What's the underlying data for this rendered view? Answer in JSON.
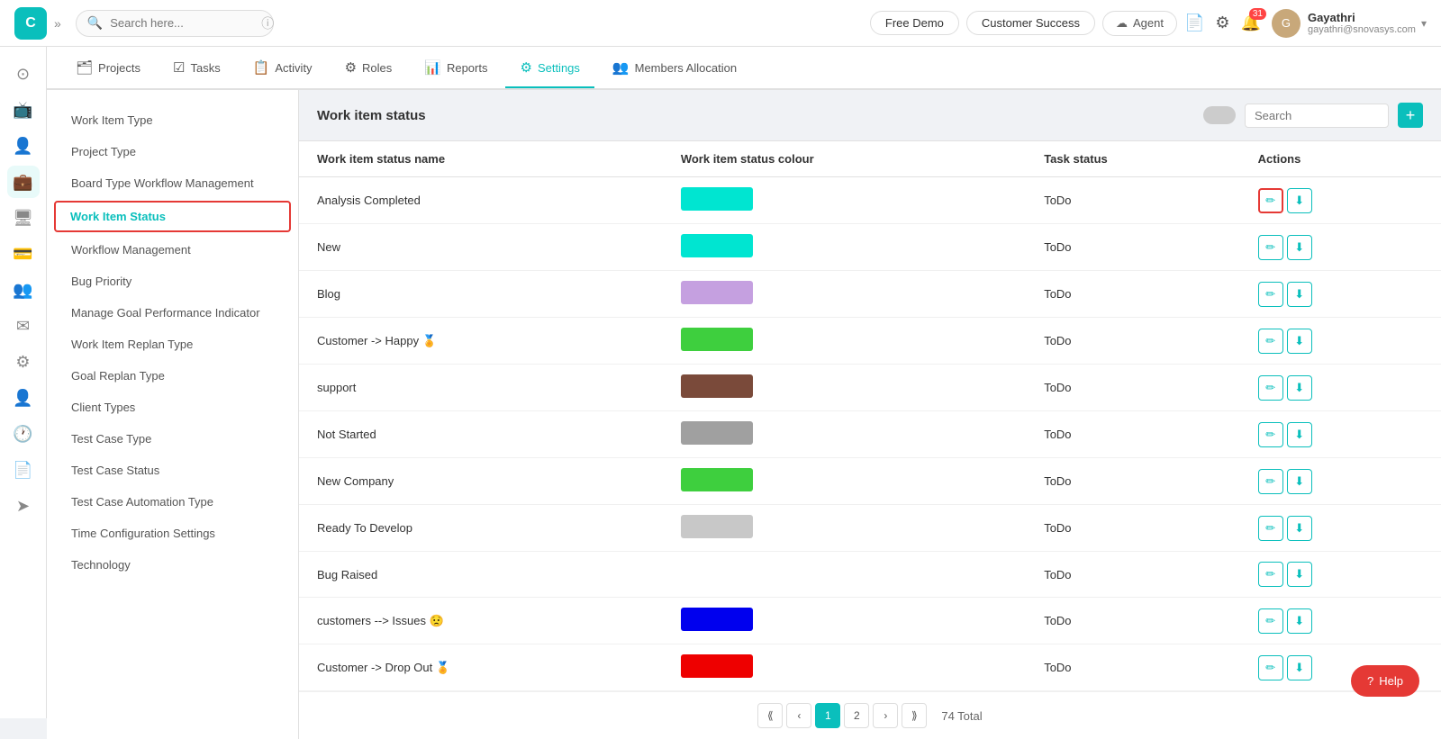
{
  "topbar": {
    "logo_letter": "C",
    "search_placeholder": "Search here...",
    "free_demo_label": "Free Demo",
    "customer_success_label": "Customer Success",
    "agent_label": "Agent",
    "notification_count": "31",
    "user": {
      "name": "Gayathri",
      "email": "gayathri@snovasys.com"
    }
  },
  "sidebar_icons": [
    {
      "name": "home-icon",
      "symbol": "⊙",
      "active": false
    },
    {
      "name": "tv-icon",
      "symbol": "📺",
      "active": false
    },
    {
      "name": "person-icon",
      "symbol": "👤",
      "active": false
    },
    {
      "name": "briefcase-icon",
      "symbol": "💼",
      "active": true
    },
    {
      "name": "monitor-icon",
      "symbol": "🖥",
      "active": false
    },
    {
      "name": "card-icon",
      "symbol": "💳",
      "active": false
    },
    {
      "name": "team-icon",
      "symbol": "👥",
      "active": false
    },
    {
      "name": "mail-icon",
      "symbol": "✉",
      "active": false
    },
    {
      "name": "gear-icon",
      "symbol": "⚙",
      "active": false
    },
    {
      "name": "user2-icon",
      "symbol": "👤",
      "active": false
    },
    {
      "name": "clock-icon",
      "symbol": "🕐",
      "active": false
    },
    {
      "name": "doc-icon",
      "symbol": "📄",
      "active": false
    },
    {
      "name": "send-icon",
      "symbol": "➤",
      "active": false
    }
  ],
  "nav_tabs": [
    {
      "id": "projects",
      "label": "Projects",
      "icon": "🗂",
      "active": false
    },
    {
      "id": "tasks",
      "label": "Tasks",
      "icon": "☑",
      "active": false
    },
    {
      "id": "activity",
      "label": "Activity",
      "icon": "📋",
      "active": false
    },
    {
      "id": "roles",
      "label": "Roles",
      "icon": "⚙",
      "active": false
    },
    {
      "id": "reports",
      "label": "Reports",
      "icon": "📊",
      "active": false
    },
    {
      "id": "settings",
      "label": "Settings",
      "icon": "⚙",
      "active": true
    },
    {
      "id": "members",
      "label": "Members Allocation",
      "icon": "👥",
      "active": false
    }
  ],
  "left_menu": [
    {
      "id": "work-item-type",
      "label": "Work Item Type",
      "active": false
    },
    {
      "id": "project-type",
      "label": "Project Type",
      "active": false
    },
    {
      "id": "board-type-workflow",
      "label": "Board Type Workflow Management",
      "active": false
    },
    {
      "id": "work-item-status",
      "label": "Work Item Status",
      "active": true
    },
    {
      "id": "workflow-management",
      "label": "Workflow Management",
      "active": false
    },
    {
      "id": "bug-priority",
      "label": "Bug Priority",
      "active": false
    },
    {
      "id": "manage-goal-performance",
      "label": "Manage Goal Performance Indicator",
      "active": false
    },
    {
      "id": "work-item-replan",
      "label": "Work Item Replan Type",
      "active": false
    },
    {
      "id": "goal-replan-type",
      "label": "Goal Replan Type",
      "active": false
    },
    {
      "id": "client-types",
      "label": "Client Types",
      "active": false
    },
    {
      "id": "test-case-type",
      "label": "Test Case Type",
      "active": false
    },
    {
      "id": "test-case-status",
      "label": "Test Case Status",
      "active": false
    },
    {
      "id": "test-case-automation",
      "label": "Test Case Automation Type",
      "active": false
    },
    {
      "id": "time-config",
      "label": "Time Configuration Settings",
      "active": false
    },
    {
      "id": "technology",
      "label": "Technology",
      "active": false
    }
  ],
  "panel": {
    "title": "Work item status",
    "search_placeholder": "Search",
    "add_btn_label": "+"
  },
  "table": {
    "columns": [
      "Work item status name",
      "Work item status colour",
      "Task status",
      "Actions"
    ],
    "rows": [
      {
        "name": "Analysis Completed",
        "color": "#00e5d1",
        "task_status": "ToDo",
        "highlight_edit": true
      },
      {
        "name": "New",
        "color": "#00e5d1",
        "task_status": "ToDo",
        "highlight_edit": false
      },
      {
        "name": "Blog",
        "color": "#c5a0e0",
        "task_status": "ToDo",
        "highlight_edit": false
      },
      {
        "name": "Customer -> Happy 🏅",
        "color": "#3ecf3e",
        "task_status": "ToDo",
        "highlight_edit": false
      },
      {
        "name": "support",
        "color": "#7a4a3a",
        "task_status": "ToDo",
        "highlight_edit": false
      },
      {
        "name": "Not Started",
        "color": "#a0a0a0",
        "task_status": "ToDo",
        "highlight_edit": false
      },
      {
        "name": "New Company",
        "color": "#3ecf3e",
        "task_status": "ToDo",
        "highlight_edit": false
      },
      {
        "name": "Ready To Develop",
        "color": "#c8c8c8",
        "task_status": "ToDo",
        "highlight_edit": false
      },
      {
        "name": "Bug Raised",
        "color": "",
        "task_status": "ToDo",
        "highlight_edit": false
      },
      {
        "name": "customers --> Issues 😟",
        "color": "#0000ee",
        "task_status": "ToDo",
        "highlight_edit": false
      },
      {
        "name": "Customer -> Drop Out 🏅",
        "color": "#ee0000",
        "task_status": "ToDo",
        "highlight_edit": false
      }
    ]
  },
  "pagination": {
    "current_page": 1,
    "total_pages": 2,
    "total": "74 Total"
  },
  "help_button": {
    "label": "Help",
    "icon": "?"
  }
}
